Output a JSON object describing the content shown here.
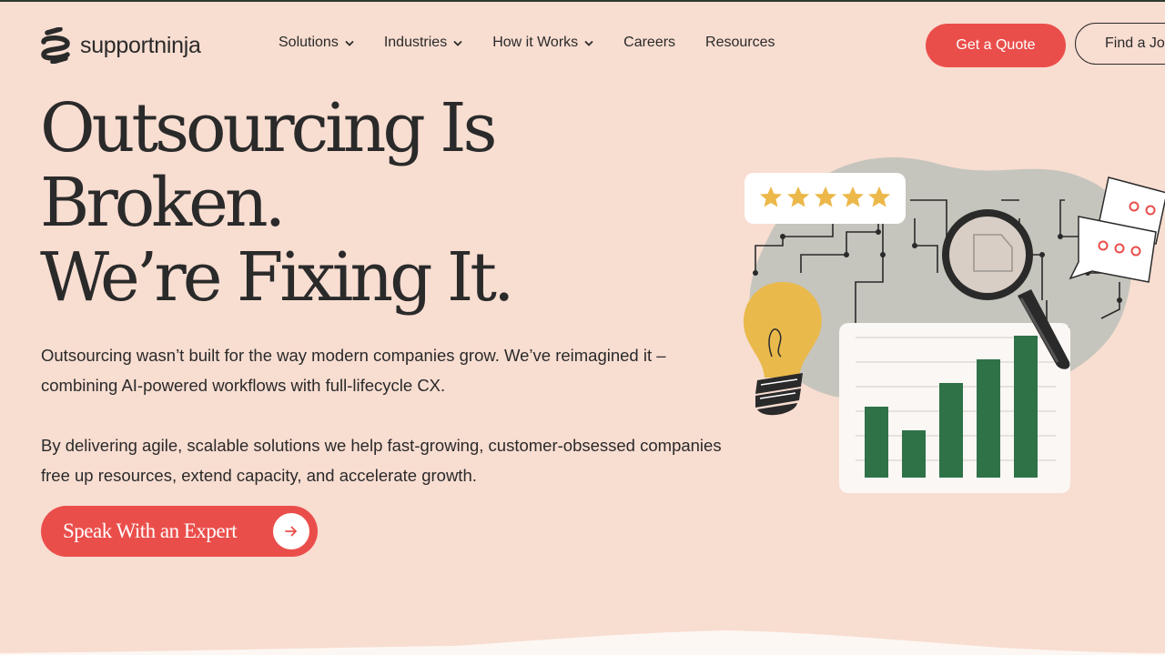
{
  "brand": {
    "name": "supportninja",
    "accent": "#ea4e4b",
    "chart_green": "#2f7248",
    "star_color": "#ecb84a"
  },
  "nav": {
    "items": [
      {
        "label": "Solutions",
        "has_dropdown": true
      },
      {
        "label": "Industries",
        "has_dropdown": true
      },
      {
        "label": "How it Works",
        "has_dropdown": true
      },
      {
        "label": "Careers",
        "has_dropdown": false
      },
      {
        "label": "Resources",
        "has_dropdown": false
      }
    ],
    "quote_label": "Get a Quote",
    "job_label": "Find a Job"
  },
  "hero": {
    "title_lines": [
      "Outsourcing Is",
      "Broken.",
      "We’re Fixing It."
    ],
    "paragraph1": "Outsourcing wasn’t built for the way modern companies grow. We’ve reimagined it – combining AI-powered workflows with full-lifecycle CX.",
    "paragraph2": "By delivering agile, scalable solutions we help fast-growing, customer-obsessed companies free up resources, extend capacity, and accelerate growth.",
    "cta_label": "Speak With an Expert",
    "cta_icon": "arrow-right-icon"
  },
  "illustration": {
    "rating_stars": 5,
    "bar_values": [
      3,
      2,
      4,
      5,
      6
    ],
    "icons": [
      "star-icon",
      "magnifier-icon",
      "lightbulb-icon",
      "chat-bubble-icon",
      "bar-chart-icon"
    ]
  }
}
